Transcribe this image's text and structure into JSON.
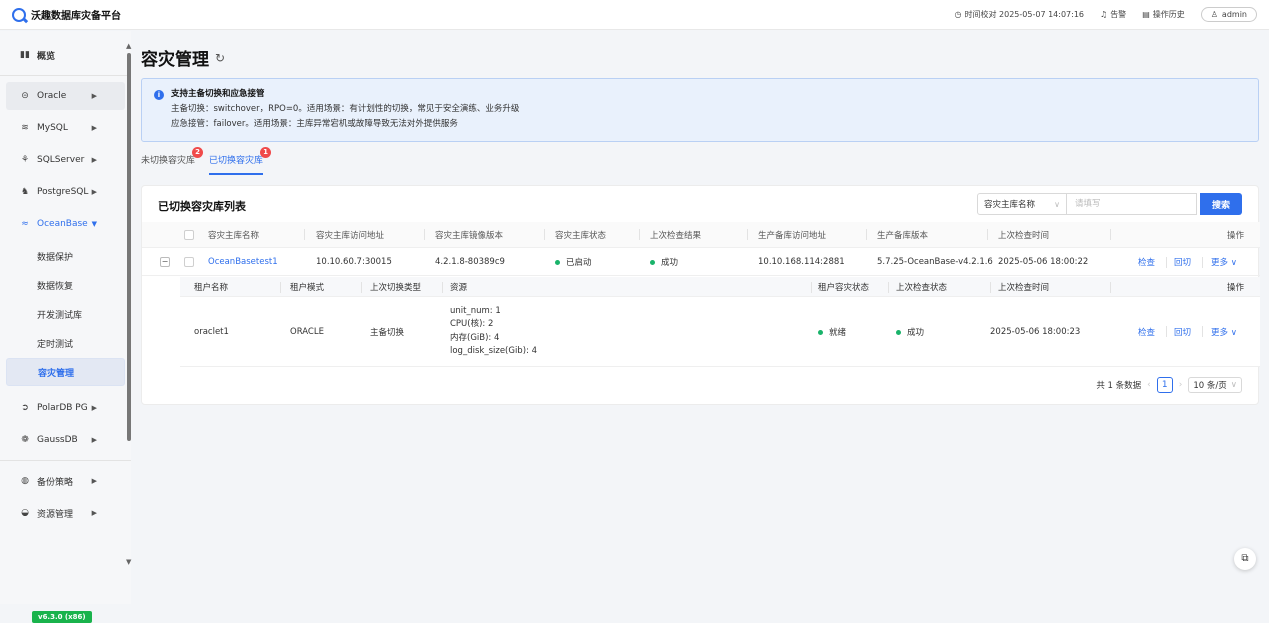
{
  "app": {
    "title": "沃趣数据库灾备平台"
  },
  "topbar": {
    "time_sync": "时间校对 2025-05-07 14:07:16",
    "alert": "告警",
    "history": "操作历史",
    "user": "admin"
  },
  "sidebar": {
    "overview": "概览",
    "items": [
      {
        "label": "Oracle",
        "icon": "database-icon"
      },
      {
        "label": "MySQL",
        "icon": "mysql-icon"
      },
      {
        "label": "SQLServer",
        "icon": "sqlserver-icon"
      },
      {
        "label": "PostgreSQL",
        "icon": "postgresql-icon"
      },
      {
        "label": "OceanBase",
        "icon": "oceanbase-icon"
      },
      {
        "label": "PolarDB PG",
        "icon": "polardb-icon"
      },
      {
        "label": "GaussDB",
        "icon": "gaussdb-icon"
      },
      {
        "label": "备份策略",
        "icon": "backup-icon"
      },
      {
        "label": "资源管理",
        "icon": "resource-icon"
      }
    ],
    "oceanbase_sub": [
      "数据保护",
      "数据恢复",
      "开发测试库",
      "定时测试",
      "容灾管理"
    ],
    "version": "v6.3.0 (x86)"
  },
  "page": {
    "title": "容灾管理",
    "alert_title": "支持主备切换和应急接管",
    "alert_line1": "主备切换：switchover，RPO=0。适用场景：有计划性的切换，常见于安全演练、业务升级",
    "alert_line2": "应急接管：failover。适用场景：主库异常宕机或故障导致无法对外提供服务",
    "tab1": "未切换容灾库",
    "tab1_badge": "2",
    "tab2": "已切换容灾库",
    "tab2_badge": "1"
  },
  "list": {
    "title": "已切换容灾库列表",
    "filter_field": "容灾主库名称",
    "filter_placeholder": "请填写",
    "search": "搜索",
    "headers": [
      "容灾主库名称",
      "容灾主库访问地址",
      "容灾主库镜像版本",
      "容灾主库状态",
      "上次检查结果",
      "生产备库访问地址",
      "生产备库版本",
      "上次检查时间",
      "操作"
    ],
    "row": {
      "name": "OceanBasetest1",
      "address": "10.10.60.7:30015",
      "image": "4.2.1.8-80389c9",
      "status": "已启动",
      "check_result": "成功",
      "prod_address": "10.10.168.114:2881",
      "prod_version": "5.7.25-OceanBase-v4.2.1.6",
      "check_time": "2025-05-06 18:00:22",
      "actions": [
        "检查",
        "回切",
        "更多"
      ]
    },
    "sub_headers": [
      "租户名称",
      "租户模式",
      "上次切换类型",
      "资源",
      "租户容灾状态",
      "上次检查状态",
      "上次检查时间",
      "操作"
    ],
    "sub_row": {
      "tenant": "oraclet1",
      "mode": "ORACLE",
      "switch_type": "主备切换",
      "resources": [
        "unit_num: 1",
        "CPU(核): 2",
        "内存(GiB): 4",
        "log_disk_size(Gib): 4"
      ],
      "dr_status": "就绪",
      "check_status": "成功",
      "check_time": "2025-05-06 18:00:23",
      "actions": [
        "检查",
        "回切",
        "更多"
      ]
    },
    "pager": {
      "total": "共 1 条数据",
      "page": "1",
      "size": "10 条/页"
    }
  },
  "colors": {
    "primary": "#2f6fec",
    "success": "#19b36a",
    "badge": "#f04a4a"
  }
}
